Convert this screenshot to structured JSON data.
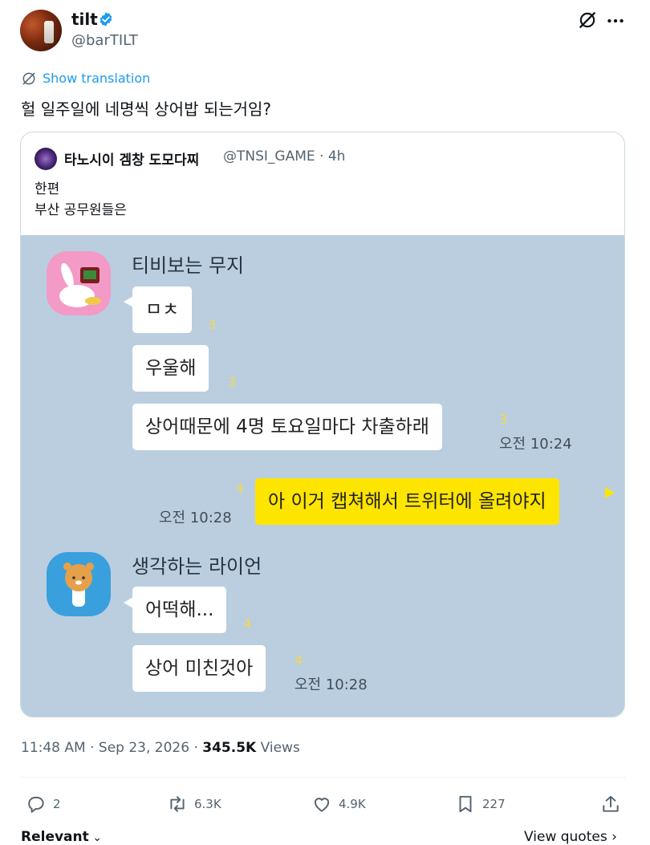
{
  "author": {
    "display_name": "tilt",
    "handle": "@barTILT"
  },
  "translation": {
    "label": "Show translation"
  },
  "tweet": {
    "text": "헐 일주일에 네명씩 상어밥 되는거임?"
  },
  "quote": {
    "display_name": "타노시이 겜창 도모다찌",
    "meta": "@TNSI_GAME · 4h",
    "lines": [
      "한편",
      "부산 공무원들은"
    ],
    "chat": {
      "sender1": "티비보는 무지",
      "m1": "ㅁㅊ",
      "m1_unread": "3",
      "m2": "우울해",
      "m2_unread": "3",
      "m3": "상어때문에 4명 토요일마다 차출하래",
      "m3_unread": "3",
      "m3_time": "오전 10:24",
      "my_msg": "아 이거 캡쳐해서 트위터에 올려야지",
      "my_unread": "4",
      "my_time": "오전 10:28",
      "sender2": "생각하는 라이언",
      "m4": "어떡해...",
      "m4_unread": "4",
      "m5": "상어 미친것아",
      "m5_unread": "4",
      "m5_time": "오전 10:28"
    }
  },
  "meta": {
    "time_date": "11:48 AM · Sep 23, 2026 · ",
    "views_count": "345.5K",
    "views_label": " Views"
  },
  "actions": {
    "replies": "2",
    "reposts": "6.3K",
    "likes": "4.9K",
    "bookmarks": "227"
  },
  "tabs": {
    "relevant": "Relevant",
    "view_quotes": "View quotes"
  },
  "colors": {
    "accent": "#1d9bf0",
    "kakao_bg": "#bacee0",
    "kakao_yellow": "#fee500"
  },
  "icons": [
    "verified-icon",
    "grok-icon",
    "more-icon",
    "translate-icon",
    "reply-icon",
    "repost-icon",
    "like-icon",
    "bookmark-icon",
    "share-icon",
    "chevron-down-icon",
    "chevron-right-icon"
  ]
}
